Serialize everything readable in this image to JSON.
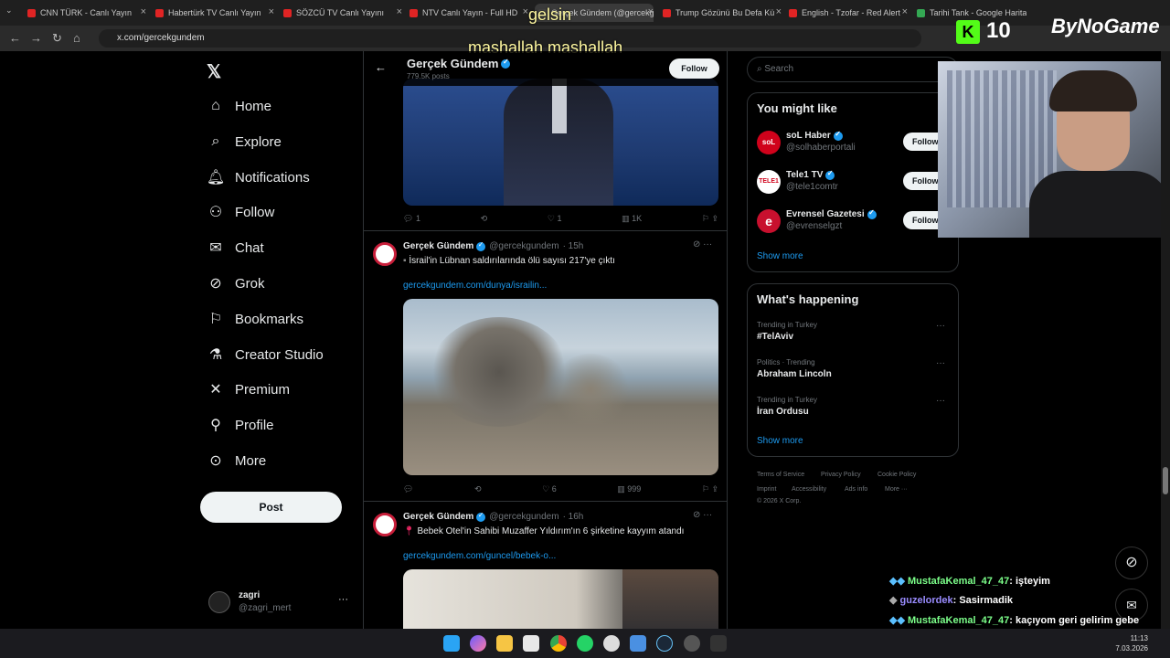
{
  "browser": {
    "tabs": [
      {
        "label": "CNN TÜRK - Canlı Yayın"
      },
      {
        "label": "Habertürk TV Canlı Yayın"
      },
      {
        "label": "SÖZCÜ TV Canlı Yayını"
      },
      {
        "label": "NTV Canlı Yayın - Full HD"
      },
      {
        "label": "Gerçek Gündem (@gercekgundem)"
      },
      {
        "label": "Trump Gözünü Bu Defa Kü"
      },
      {
        "label": "English - Tzofar - Red Alert"
      },
      {
        "label": "Tarihi Tank - Google Haritalar"
      }
    ],
    "url": "x.com/gercekgundem"
  },
  "stream_overlay": {
    "caption1": "gelsin",
    "caption2": "mashallah mashallah",
    "kick_count": "10",
    "brand": "ByNoGame"
  },
  "nav": {
    "items": [
      {
        "label": "Home",
        "icon": "home-icon"
      },
      {
        "label": "Explore",
        "icon": "search-icon"
      },
      {
        "label": "Notifications",
        "icon": "bell-icon"
      },
      {
        "label": "Follow",
        "icon": "add-person-icon"
      },
      {
        "label": "Chat",
        "icon": "mail-icon"
      },
      {
        "label": "Grok",
        "icon": "grok-icon"
      },
      {
        "label": "Bookmarks",
        "icon": "bookmark-icon"
      },
      {
        "label": "Creator Studio",
        "icon": "flask-icon"
      },
      {
        "label": "Premium",
        "icon": "x-icon"
      },
      {
        "label": "Profile",
        "icon": "person-icon"
      },
      {
        "label": "More",
        "icon": "more-circle-icon"
      }
    ],
    "post_label": "Post",
    "account_name": "zagri",
    "account_handle": "@zagri_mert"
  },
  "profile_header": {
    "name": "Gerçek Gündem",
    "posts": "779.5K posts",
    "follow_label": "Follow"
  },
  "tweets": [
    {
      "replies": "1",
      "likes": "1",
      "views": "1K"
    },
    {
      "name": "Gerçek Gündem",
      "handle": "@gercekgundem",
      "time": "· 15h",
      "text": "İsrail'in Lübnan saldırılarında ölü sayısı 217'ye çıktı",
      "link": "gercekgundem.com/dunya/israilin...",
      "likes": "6",
      "views": "999"
    },
    {
      "name": "Gerçek Gündem",
      "handle": "@gercekgundem",
      "time": "· 16h",
      "text": "Bebek Otel'in Sahibi Muzaffer Yıldırım'ın 6 şirketine kayyım atandı",
      "link": "gercekgundem.com/guncel/bebek-o..."
    }
  ],
  "search": {
    "placeholder": "Search"
  },
  "you_might_like": {
    "title": "You might like",
    "accounts": [
      {
        "name": "soL Haber",
        "handle": "@solhaberportali",
        "follow": "Follow"
      },
      {
        "name": "Tele1 TV",
        "handle": "@tele1comtr",
        "follow": "Follow"
      },
      {
        "name": "Evrensel Gazetesi",
        "handle": "@evrenselgzt",
        "follow": "Follow"
      }
    ],
    "show_more": "Show more"
  },
  "whats_happening": {
    "title": "What's happening",
    "trends": [
      {
        "category": "Trending in Turkey",
        "title": "#TelAviv"
      },
      {
        "category": "Politics · Trending",
        "title": "Abraham Lincoln"
      },
      {
        "category": "Trending in Turkey",
        "title": "İran Ordusu"
      }
    ],
    "show_more": "Show more"
  },
  "footer": {
    "links": [
      "Terms of Service",
      "Privacy Policy",
      "Cookie Policy",
      "Imprint",
      "Accessibility",
      "Ads info",
      "More ···"
    ],
    "copyright": "© 2026 X Corp."
  },
  "chat": [
    {
      "user": "MustafaKemal_47_47",
      "msg": ": işteyim"
    },
    {
      "user": "guzelordek",
      "msg": ": Sasirmadik"
    },
    {
      "user": "MustafaKemal_47_47",
      "msg": ": kaçıyom geri gelirim gebe"
    }
  ],
  "taskbar": {
    "time": "11:13",
    "date": "7.03.2026"
  },
  "colors": {
    "accent": "#1d9bf0",
    "background": "#000000",
    "border": "#2f3336"
  }
}
